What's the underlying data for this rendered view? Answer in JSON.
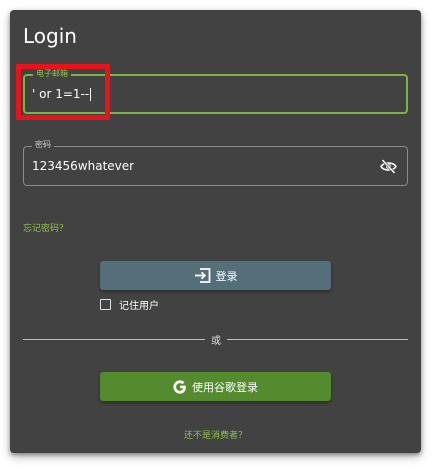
{
  "title": "Login",
  "email_field": {
    "label": "电子邮箱",
    "value": "' or 1=1--"
  },
  "password_field": {
    "label": "密码",
    "value": "123456whatever",
    "visibility_icon": "eye-off-icon"
  },
  "forgot_password": "忘记密码？",
  "login_button": {
    "label": "登录",
    "icon": "login-icon"
  },
  "remember_me": {
    "label": "记住用户",
    "checked": false
  },
  "divider": {
    "text": "或"
  },
  "google_button": {
    "label": "使用谷歌登录",
    "icon": "google-icon"
  },
  "not_consumer_link": "还不是消费者？",
  "colors": {
    "card_background": "#424242",
    "accent_green": "#8bc34a",
    "login_button": "#546e7a",
    "google_button": "#558b2f",
    "highlight_box": "#e8121b"
  }
}
